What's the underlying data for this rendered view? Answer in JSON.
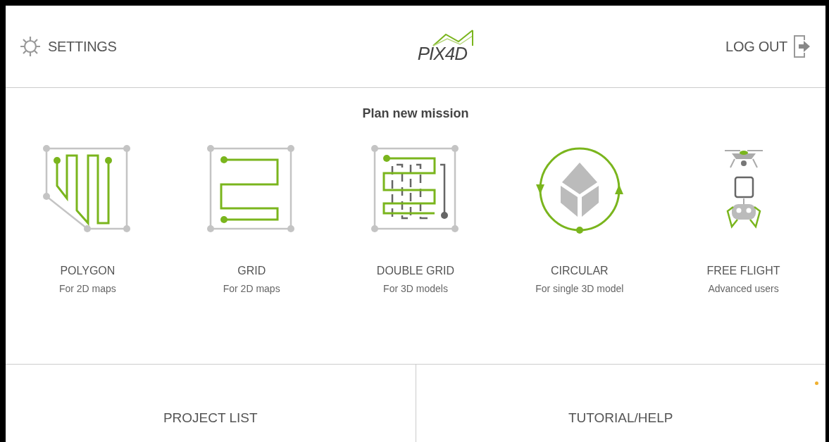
{
  "header": {
    "settings": "SETTINGS",
    "logo": "PIX4D",
    "logout": "LOG OUT"
  },
  "mission_panel": {
    "title": "Plan new mission",
    "missions": [
      {
        "kind": "polygon",
        "title": "POLYGON",
        "subtitle": "For 2D maps"
      },
      {
        "kind": "grid",
        "title": "GRID",
        "subtitle": "For 2D maps"
      },
      {
        "kind": "double_grid",
        "title": "DOUBLE GRID",
        "subtitle": "For 3D models"
      },
      {
        "kind": "circular",
        "title": "CIRCULAR",
        "subtitle": "For single 3D model"
      },
      {
        "kind": "free_flight",
        "title": "FREE FLIGHT",
        "subtitle": "Advanced users"
      }
    ]
  },
  "footer": {
    "buttons": [
      "PROJECT LIST",
      "TUTORIAL/HELP"
    ]
  }
}
